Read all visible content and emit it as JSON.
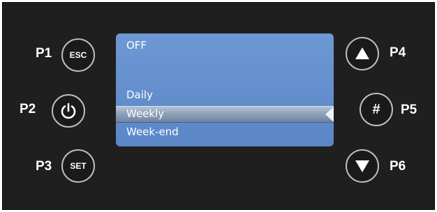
{
  "buttons": {
    "p1": {
      "label": "P1",
      "glyph": "ESC"
    },
    "p2": {
      "label": "P2",
      "icon": "power-icon"
    },
    "p3": {
      "label": "P3",
      "glyph": "SET"
    },
    "p4": {
      "label": "P4",
      "icon": "arrow-up-icon"
    },
    "p5": {
      "label": "P5",
      "glyph": "#"
    },
    "p6": {
      "label": "P6",
      "icon": "arrow-down-icon"
    }
  },
  "screen": {
    "items": [
      "OFF",
      "",
      "Daily",
      "Weekly",
      "Week-end"
    ],
    "selected": "Weekly"
  },
  "colors": {
    "panel": "#201f1f",
    "screen": "#5b86c7",
    "button_ring": "#bdbdbd",
    "text": "#ffffff"
  }
}
